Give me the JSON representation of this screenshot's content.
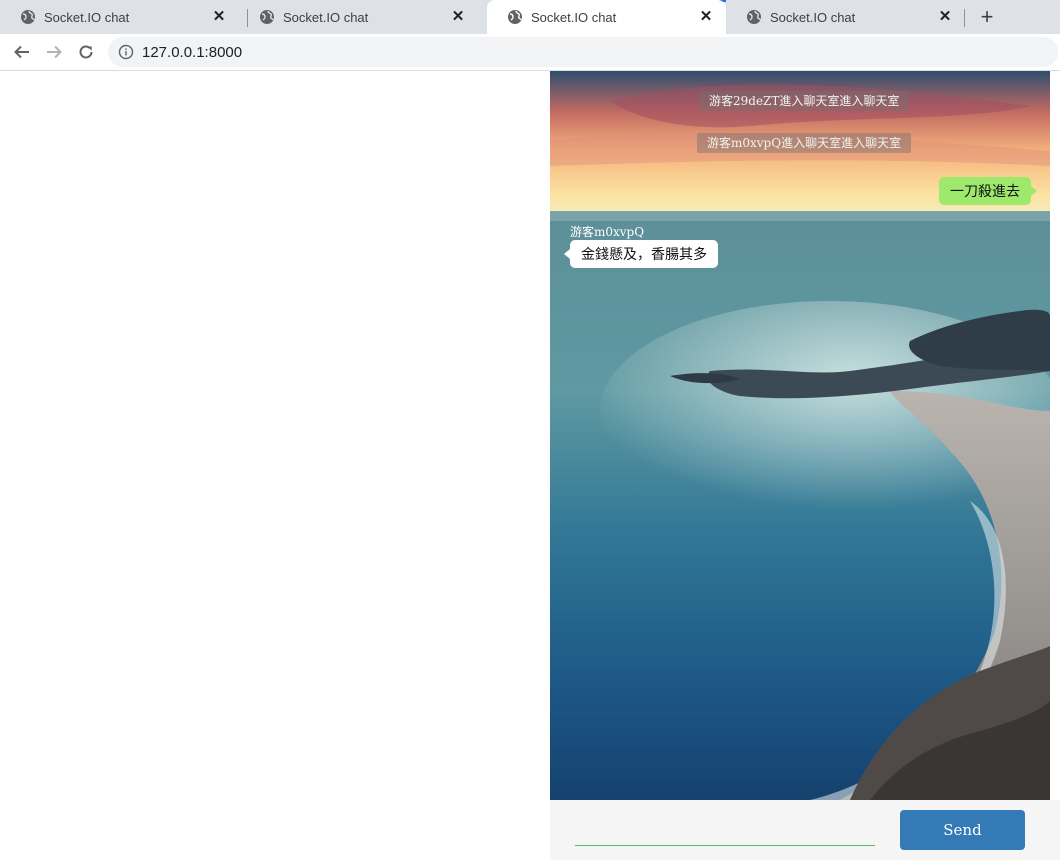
{
  "browser": {
    "tabs": [
      {
        "title": "Socket.IO chat"
      },
      {
        "title": "Socket.IO chat"
      },
      {
        "title": "Socket.IO chat"
      },
      {
        "title": "Socket.IO chat"
      }
    ],
    "active_tab_index": 2,
    "new_tab_label": "+",
    "close_label": "✕",
    "url": "127.0.0.1:8000"
  },
  "chat": {
    "system_messages": [
      {
        "text": "游客29deZT進入聊天室進入聊天室"
      },
      {
        "text": "游客m0xvpQ進入聊天室進入聊天室"
      }
    ],
    "my_message": {
      "text": "一刀殺進去"
    },
    "their_message": {
      "sender": "游客m0xvpQ",
      "text": "金錢懸及，香腸其多"
    }
  },
  "composer": {
    "input_value": "",
    "send_label": "Send"
  },
  "colors": {
    "send_button": "#337ab7",
    "my_bubble": "#9ee86b",
    "input_underline": "#5cb85c",
    "active_tab_indicator": "#1a73e8"
  }
}
